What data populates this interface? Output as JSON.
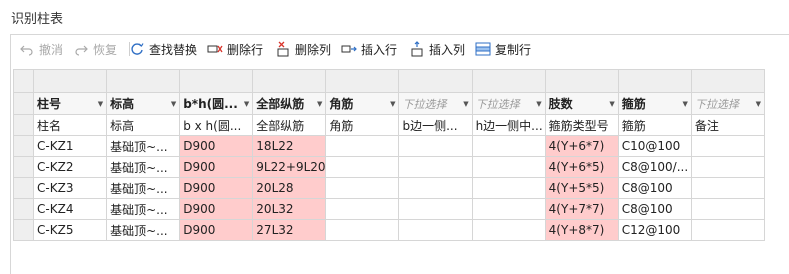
{
  "window_title": "识别柱表",
  "toolbar": [
    {
      "label": "撤消",
      "icon": "undo-icon",
      "disabled": true
    },
    {
      "label": "恢复",
      "icon": "redo-icon",
      "disabled": true
    },
    {
      "label": "查找替换",
      "icon": "find-replace-icon",
      "disabled": false
    },
    {
      "label": "删除行",
      "icon": "delete-row-icon",
      "disabled": false
    },
    {
      "label": "删除列",
      "icon": "delete-column-icon",
      "disabled": false
    },
    {
      "label": "插入行",
      "icon": "insert-row-icon",
      "disabled": false
    },
    {
      "label": "插入列",
      "icon": "insert-column-icon",
      "disabled": false
    },
    {
      "label": "复制行",
      "icon": "copy-row-icon",
      "disabled": false
    }
  ],
  "columns": [
    {
      "header": "柱号",
      "placeholder": false,
      "sub": "柱名"
    },
    {
      "header": "标高",
      "placeholder": false,
      "sub": "标高"
    },
    {
      "header": "b*h(圆...",
      "placeholder": false,
      "sub": "b x h(圆..."
    },
    {
      "header": "全部纵筋",
      "placeholder": false,
      "sub": "全部纵筋"
    },
    {
      "header": "角筋",
      "placeholder": false,
      "sub": "角筋"
    },
    {
      "header": "下拉选择",
      "placeholder": true,
      "sub": "b边一侧..."
    },
    {
      "header": "下拉选择",
      "placeholder": true,
      "sub": "h边一侧中..."
    },
    {
      "header": "肢数",
      "placeholder": false,
      "sub": "箍筋类型号"
    },
    {
      "header": "箍筋",
      "placeholder": false,
      "sub": "箍筋"
    },
    {
      "header": "下拉选择",
      "placeholder": true,
      "sub": "备注"
    }
  ],
  "rows": [
    [
      "C-KZ1",
      "基础顶~...",
      "D900",
      "18L22",
      "",
      "",
      "",
      "4(Y+6*7)",
      "C10@100",
      ""
    ],
    [
      "C-KZ2",
      "基础顶~...",
      "D900",
      "9L22+9L20",
      "",
      "",
      "",
      "4(Y+6*5)",
      "C8@100/...",
      ""
    ],
    [
      "C-KZ3",
      "基础顶~...",
      "D900",
      "20L28",
      "",
      "",
      "",
      "4(Y+5*5)",
      "C8@100",
      ""
    ],
    [
      "C-KZ4",
      "基础顶~...",
      "D900",
      "20L32",
      "",
      "",
      "",
      "4(Y+7*7)",
      "C8@100",
      ""
    ],
    [
      "C-KZ5",
      "基础顶~...",
      "D900",
      "27L32",
      "",
      "",
      "",
      "4(Y+8*7)",
      "C12@100",
      ""
    ]
  ],
  "colors": {
    "highlight": "#ffcccc",
    "accent": "#2f6fc5",
    "delete_red": "#d9342b"
  }
}
